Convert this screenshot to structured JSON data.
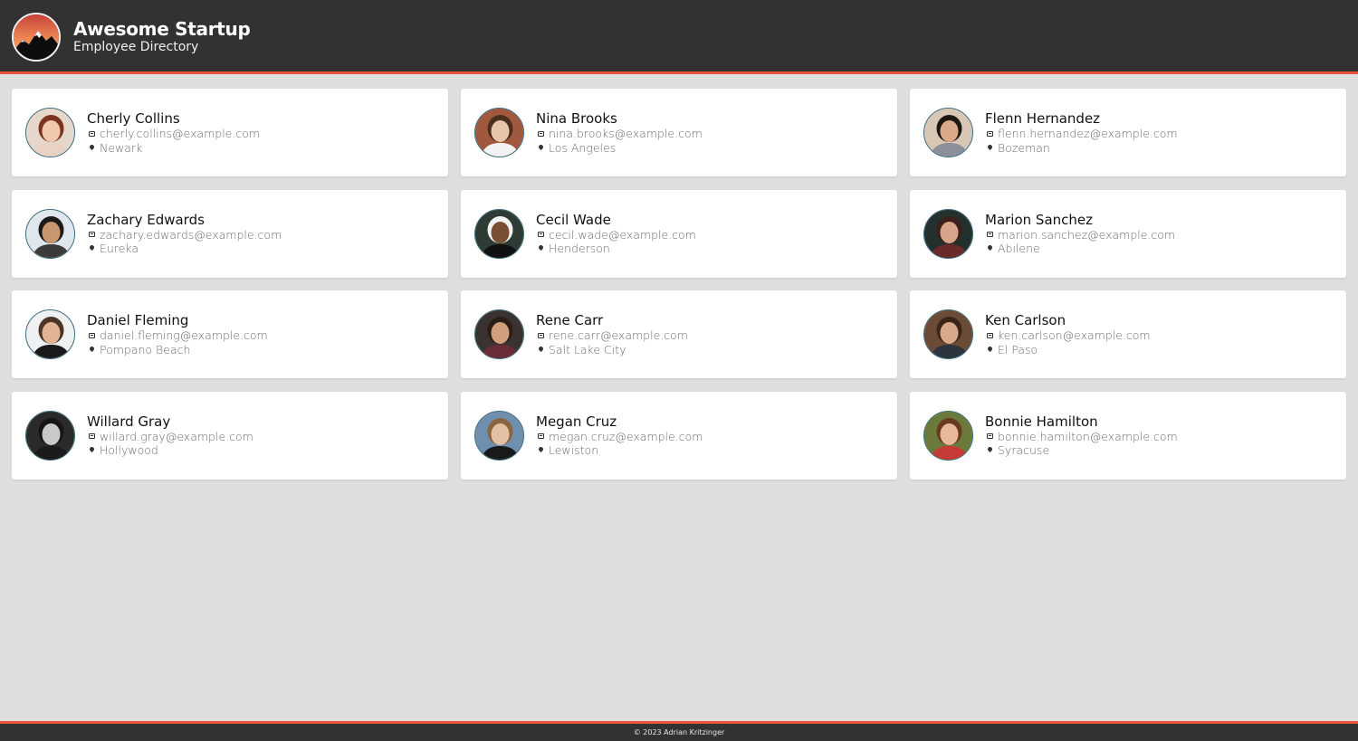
{
  "header": {
    "logo_icon": "mountain-logo-icon",
    "title": "Awesome Startup",
    "subtitle": "Employee Directory"
  },
  "colors": {
    "header_bg": "#323232",
    "accent": "#e8523a",
    "page_bg": "#dedede",
    "card_bg": "#ffffff"
  },
  "employees": [
    {
      "name": "Cherly Collins",
      "email": "cherly.collins@example.com",
      "city": "Newark",
      "photo_colors": {
        "bg": "#e6d7cc",
        "hair": "#7a3420",
        "skin": "#f1c9ad",
        "shirt": "#e7d2c4"
      }
    },
    {
      "name": "Nina Brooks",
      "email": "nina.brooks@example.com",
      "city": "Los Angeles",
      "photo_colors": {
        "bg": "#a0593e",
        "hair": "#4c2e1e",
        "skin": "#e8c4a8",
        "shirt": "#f2f2f2"
      }
    },
    {
      "name": "Flenn Hernandez",
      "email": "flenn.hernandez@example.com",
      "city": "Bozeman",
      "photo_colors": {
        "bg": "#d8c7b5",
        "hair": "#1f1712",
        "skin": "#d9a988",
        "shirt": "#8a8f99"
      }
    },
    {
      "name": "Zachary Edwards",
      "email": "zachary.edwards@example.com",
      "city": "Eureka",
      "photo_colors": {
        "bg": "#dfe6ee",
        "hair": "#1c1a18",
        "skin": "#c9976f",
        "shirt": "#3d3a3a"
      }
    },
    {
      "name": "Cecil Wade",
      "email": "cecil.wade@example.com",
      "city": "Henderson",
      "photo_colors": {
        "bg": "#2e3b34",
        "hair": "#f2f2f2",
        "skin": "#7a4e33",
        "shirt": "#111111"
      }
    },
    {
      "name": "Marion Sanchez",
      "email": "marion.sanchez@example.com",
      "city": "Abilene",
      "photo_colors": {
        "bg": "#23302d",
        "hair": "#3a1f1a",
        "skin": "#d8a48a",
        "shirt": "#6a2a2a"
      }
    },
    {
      "name": "Daniel Fleming",
      "email": "daniel.fleming@example.com",
      "city": "Pompano Beach",
      "photo_colors": {
        "bg": "#eef0f2",
        "hair": "#4a3526",
        "skin": "#e1b594",
        "shirt": "#1a1a1a"
      }
    },
    {
      "name": "Rene Carr",
      "email": "rene.carr@example.com",
      "city": "Salt Lake City",
      "photo_colors": {
        "bg": "#3a3230",
        "hair": "#2a1d16",
        "skin": "#d29f7d",
        "shirt": "#6a2c36"
      }
    },
    {
      "name": "Ken Carlson",
      "email": "ken.carlson@example.com",
      "city": "El Paso",
      "photo_colors": {
        "bg": "#6b4a36",
        "hair": "#3a2618",
        "skin": "#d8a98a",
        "shirt": "#2c3440"
      }
    },
    {
      "name": "Willard Gray",
      "email": "willard.gray@example.com",
      "city": "Hollywood",
      "photo_colors": {
        "bg": "#2a2a2a",
        "hair": "#151515",
        "skin": "#c9c9c9",
        "shirt": "#1a1a1a"
      }
    },
    {
      "name": "Megan Cruz",
      "email": "megan.cruz@example.com",
      "city": "Lewiston",
      "photo_colors": {
        "bg": "#6e8fae",
        "hair": "#8a6540",
        "skin": "#e4c0a4",
        "shirt": "#1a1a1a"
      }
    },
    {
      "name": "Bonnie Hamilton",
      "email": "bonnie.hamilton@example.com",
      "city": "Syracuse",
      "photo_colors": {
        "bg": "#6b7a3a",
        "hair": "#6a3a20",
        "skin": "#e8b89a",
        "shirt": "#c83a36"
      }
    }
  ],
  "footer": {
    "text": "© 2023 Adrian Kritzinger"
  }
}
